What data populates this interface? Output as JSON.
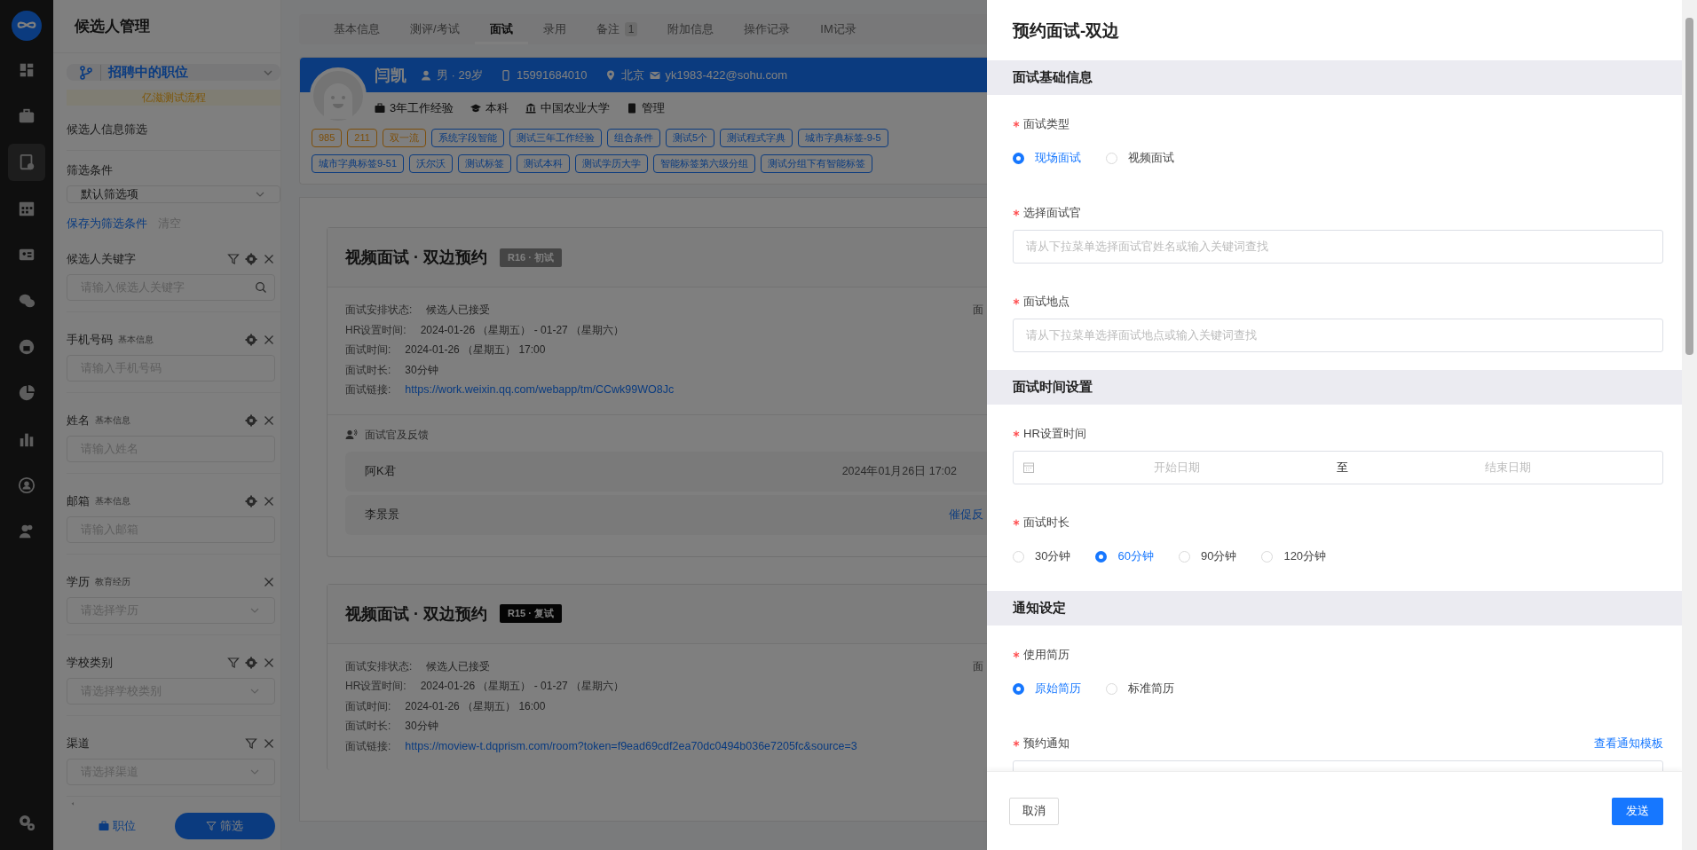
{
  "nav": {
    "items": [
      {
        "selected": false
      },
      {
        "selected": false
      },
      {
        "selected": true
      },
      {
        "selected": false
      },
      {
        "selected": false
      },
      {
        "selected": false
      },
      {
        "selected": false
      },
      {
        "selected": false
      },
      {
        "selected": false
      },
      {
        "selected": false
      },
      {
        "selected": false
      }
    ]
  },
  "filter_panel": {
    "title": "候选人管理",
    "job_selector": "招聘中的职位",
    "process": "亿滋测试流程",
    "section_title": "候选人信息筛选",
    "conditions_label": "筛选条件",
    "conditions_select": "默认筛选项",
    "save_link": "保存为筛选条件",
    "clear_link": "清空",
    "filters": [
      {
        "label": "候选人关键字",
        "has_filter": true,
        "has_settings": true,
        "kind": "search",
        "placeholder": "请输入候选人关键字"
      },
      {
        "label": "手机号码",
        "sublabel": "基本信息",
        "has_filter": false,
        "has_settings": true,
        "kind": "input",
        "placeholder": "请输入手机号码"
      },
      {
        "label": "姓名",
        "sublabel": "基本信息",
        "has_filter": false,
        "has_settings": true,
        "kind": "input",
        "placeholder": "请输入姓名"
      },
      {
        "label": "邮箱",
        "sublabel": "基本信息",
        "has_filter": false,
        "has_settings": true,
        "kind": "input",
        "placeholder": "请输入邮箱"
      },
      {
        "label": "学历",
        "sublabel": "教育经历",
        "has_filter": false,
        "has_settings": false,
        "kind": "select",
        "placeholder": "请选择学历"
      },
      {
        "label": "学校类别",
        "has_filter": true,
        "has_settings": true,
        "kind": "select",
        "placeholder": "请选择学校类别"
      },
      {
        "label": "渠道",
        "has_filter": true,
        "has_settings": false,
        "kind": "select",
        "placeholder": "请选择渠道"
      }
    ],
    "bottom_tabs": [
      {
        "label": "职位",
        "selected": false
      },
      {
        "label": "筛选",
        "selected": true
      }
    ]
  },
  "tabs": [
    {
      "label": "基本信息",
      "selected": false
    },
    {
      "label": "测评/考试",
      "selected": false
    },
    {
      "label": "面试",
      "selected": true
    },
    {
      "label": "录用",
      "selected": false
    },
    {
      "label": "备注",
      "badge": "1",
      "selected": false
    },
    {
      "label": "附加信息",
      "selected": false
    },
    {
      "label": "操作记录",
      "selected": false
    },
    {
      "label": "IM记录",
      "selected": false
    }
  ],
  "candidate": {
    "name": "闫凯",
    "gender_age": "男 · 29岁",
    "phone": "15991684010",
    "city": "北京",
    "email": "yk1983-422@sohu.com",
    "experience": "3年工作经验",
    "degree": "本科",
    "school": "中国农业大学",
    "major": "管理",
    "tags": [
      {
        "label": "985",
        "kind": "rank"
      },
      {
        "label": "211",
        "kind": "rank"
      },
      {
        "label": "双一流",
        "kind": "rank"
      },
      {
        "label": "系统字段智能",
        "kind": "custom"
      },
      {
        "label": "测试三年工作经验",
        "kind": "custom"
      },
      {
        "label": "组合条件",
        "kind": "custom"
      },
      {
        "label": "测试5个",
        "kind": "custom"
      },
      {
        "label": "测试程式字典",
        "kind": "custom"
      },
      {
        "label": "城市字典标签-9-5",
        "kind": "custom"
      },
      {
        "label": "城市字典标签9-51",
        "kind": "custom"
      },
      {
        "label": "沃尔沃",
        "kind": "custom"
      },
      {
        "label": "测试标签",
        "kind": "custom"
      },
      {
        "label": "测试本科",
        "kind": "custom"
      },
      {
        "label": "测试学历大学",
        "kind": "custom"
      },
      {
        "label": "智能标签第六级分组",
        "kind": "custom"
      },
      {
        "label": "测试分组下有智能标签",
        "kind": "custom"
      }
    ]
  },
  "interviews": [
    {
      "title": "视频面试 · 双边预约",
      "round": {
        "label": "R16 · 初试",
        "kind": "muted"
      },
      "right_text": "面",
      "rows": [
        {
          "label": "面试安排状态:",
          "value": "候选人已接受",
          "kind": "text"
        },
        {
          "label": "HR设置时间:",
          "value": "2024-01-26 （星期五） - 01-27 （星期六）",
          "kind": "text"
        },
        {
          "label": "面试时间:",
          "value": "2024-01-26 （星期五） 17:00",
          "kind": "text"
        },
        {
          "label": "面试时长:",
          "value": "30分钟",
          "kind": "text"
        },
        {
          "label": "面试链接:",
          "value": "https://work.weixin.qq.com/webapp/tm/CCwk99WO8Jc",
          "kind": "link"
        }
      ],
      "feedback": {
        "title": "面试官及反馈",
        "rows": [
          {
            "name": "阿K君",
            "time": "2024年01月26日 17:02"
          },
          {
            "name": "李景景",
            "action": "催促反"
          }
        ]
      }
    },
    {
      "title": "视频面试 · 双边预约",
      "round": {
        "label": "R15 · 复试",
        "kind": "solid"
      },
      "right_text": "面",
      "rows": [
        {
          "label": "面试安排状态:",
          "value": "候选人已接受",
          "kind": "text"
        },
        {
          "label": "HR设置时间:",
          "value": "2024-01-26 （星期五） - 01-27 （星期六）",
          "kind": "text"
        },
        {
          "label": "面试时间:",
          "value": "2024-01-26 （星期五） 16:00",
          "kind": "text"
        },
        {
          "label": "面试时长:",
          "value": "30分钟",
          "kind": "text"
        },
        {
          "label": "面试链接:",
          "value": "https://moview-t.dqprism.com/room?token=f9ead69cdf2ea70dc0494b036e7205fc&source=3",
          "kind": "link"
        }
      ]
    }
  ],
  "drawer": {
    "title": "预约面试-双边",
    "sections": [
      {
        "title": "面试基础信息",
        "fields": [
          {
            "label": "面试类型",
            "required": true,
            "kind": "radio",
            "options": [
              {
                "label": "现场面试",
                "selected": true
              },
              {
                "label": "视频面试",
                "selected": false
              }
            ]
          },
          {
            "label": "选择面试官",
            "required": true,
            "kind": "input",
            "placeholder": "请从下拉菜单选择面试官姓名或输入关键词查找"
          },
          {
            "label": "面试地点",
            "required": true,
            "kind": "input",
            "placeholder": "请从下拉菜单选择面试地点或输入关键词查找"
          }
        ]
      },
      {
        "title": "面试时间设置",
        "fields": [
          {
            "label": "HR设置时间",
            "required": true,
            "kind": "date_range",
            "start": "开始日期",
            "separator": "至",
            "end": "结束日期"
          },
          {
            "label": "面试时长",
            "required": true,
            "kind": "radio",
            "options": [
              {
                "label": "30分钟",
                "selected": false
              },
              {
                "label": "60分钟",
                "selected": true
              },
              {
                "label": "90分钟",
                "selected": false
              },
              {
                "label": "120分钟",
                "selected": false
              }
            ]
          }
        ]
      },
      {
        "title": "通知设定",
        "fields": [
          {
            "label": "使用简历",
            "required": true,
            "kind": "radio",
            "options": [
              {
                "label": "原始简历",
                "selected": true
              },
              {
                "label": "标准简历",
                "selected": false
              }
            ]
          },
          {
            "label": "预约通知",
            "required": true,
            "kind": "select",
            "link": "查看通知模板"
          }
        ]
      }
    ],
    "cancel": "取消",
    "submit": "发送"
  }
}
